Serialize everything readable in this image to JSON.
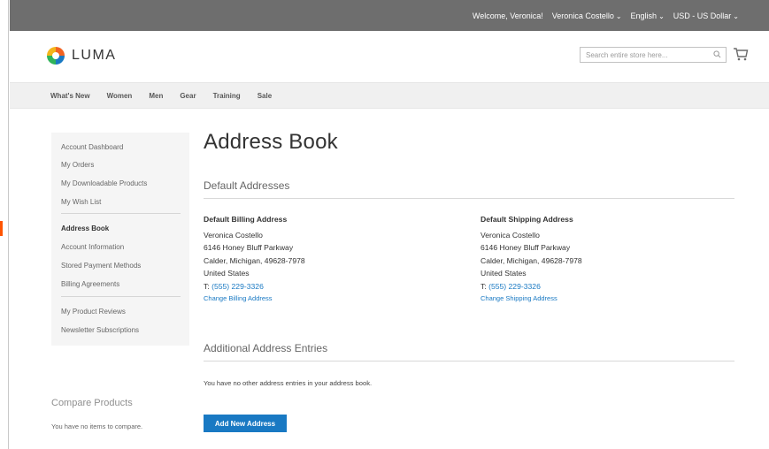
{
  "top_bar": {
    "welcome": "Welcome, Veronica!",
    "account": "Veronica Costello",
    "language": "English",
    "currency": "USD - US Dollar"
  },
  "header": {
    "logo_text": "LUMA",
    "search_placeholder": "Search entire store here..."
  },
  "nav": {
    "items": [
      "What's New",
      "Women",
      "Men",
      "Gear",
      "Training",
      "Sale"
    ]
  },
  "sidebar": {
    "items": [
      "Account Dashboard",
      "My Orders",
      "My Downloadable Products",
      "My Wish List",
      "Address Book",
      "Account Information",
      "Stored Payment Methods",
      "Billing Agreements",
      "My Product Reviews",
      "Newsletter Subscriptions"
    ],
    "current": "Address Book"
  },
  "compare": {
    "title": "Compare Products",
    "empty": "You have no items to compare."
  },
  "main": {
    "title": "Address Book",
    "default_section": "Default Addresses",
    "billing": {
      "heading": "Default Billing Address",
      "name": "Veronica Costello",
      "street": "6146 Honey Bluff Parkway",
      "city_line": "Calder, Michigan, 49628-7978",
      "country": "United States",
      "phone_prefix": "T:",
      "phone": "(555) 229-3326",
      "action": "Change Billing Address"
    },
    "shipping": {
      "heading": "Default Shipping Address",
      "name": "Veronica Costello",
      "street": "6146 Honey Bluff Parkway",
      "city_line": "Calder, Michigan, 49628-7978",
      "country": "United States",
      "phone_prefix": "T:",
      "phone": "(555) 229-3326",
      "action": "Change Shipping Address"
    },
    "additional_section": "Additional Address Entries",
    "empty_message": "You have no other address entries in your address book.",
    "add_button": "Add New Address"
  },
  "colors": {
    "accent": "#1979c3",
    "current_marker": "#ff5501",
    "top_bar_bg": "#6e6e6e"
  }
}
